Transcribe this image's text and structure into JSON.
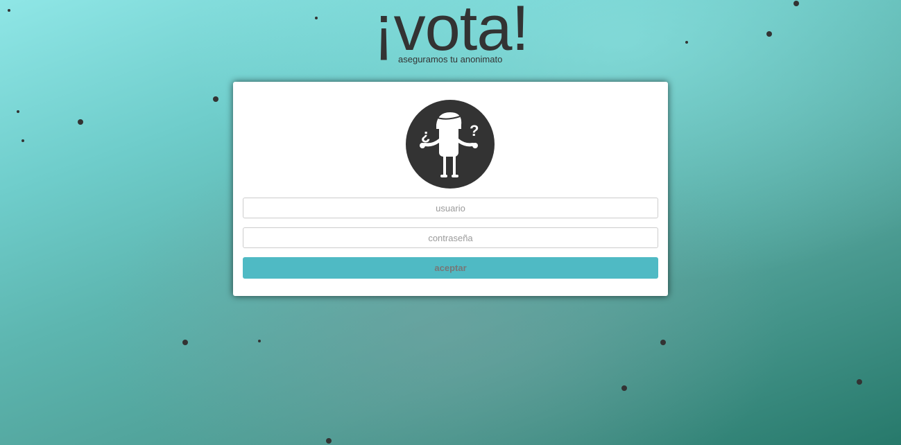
{
  "brand": {
    "title": "¡vota!",
    "tagline": "aseguramos tu anonimato"
  },
  "login": {
    "avatar_icon": "confused-person-icon",
    "username_placeholder": "usuario",
    "password_placeholder": "contraseña",
    "submit_label": "aceptar"
  },
  "colors": {
    "background_top": "#8fe6e6",
    "background_bottom": "#27796b",
    "text_dark": "#333333",
    "button": "#4fbac4",
    "card": "#ffffff"
  }
}
